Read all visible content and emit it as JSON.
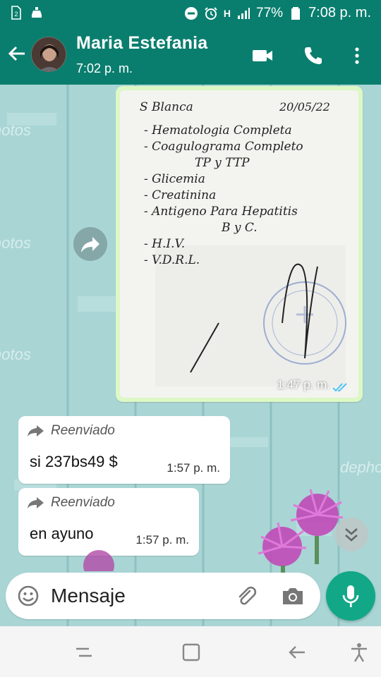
{
  "status_bar": {
    "battery_percent": "77%",
    "time": "7:08 p. m.",
    "network": "H",
    "sim_badge": "2"
  },
  "header": {
    "contact_name": "Maria Estefania",
    "last_seen": "7:02 p. m."
  },
  "messages": [
    {
      "type": "image",
      "time": "1:47 p. m.",
      "read": true,
      "photo_text": {
        "header_left": "S Blanca",
        "header_date": "20/05/22",
        "lines": [
          "- Hematologia Completa",
          "- Coagulograma Completo",
          "TP y TTP",
          "- Glicemia",
          "- Creatinina",
          "- Antigeno Para Hepatitis",
          "B y C.",
          "- H.I.V.",
          "- V.D.R.L."
        ]
      }
    },
    {
      "type": "text",
      "forwarded_label": "Reenviado",
      "text": "si 237bs49 $",
      "time": "1:57 p. m."
    },
    {
      "type": "text",
      "forwarded_label": "Reenviado",
      "text": "en ayuno",
      "time": "1:57 p. m."
    }
  ],
  "composer": {
    "placeholder": "Mensaje"
  },
  "colors": {
    "brand": "#0a7e6e",
    "outgoing_bubble": "#dcf8c6",
    "incoming_bubble": "#ffffff",
    "mic_button": "#12a887",
    "read_ticks": "#4fc3f7"
  },
  "icons": {
    "back": "arrow-left-icon",
    "video": "video-call-icon",
    "call": "phone-icon",
    "menu": "more-vert-icon",
    "forward": "forward-icon",
    "emoji": "emoji-icon",
    "attach": "paperclip-icon",
    "camera": "camera-icon",
    "mic": "mic-icon",
    "scroll": "double-chevron-down-icon"
  }
}
